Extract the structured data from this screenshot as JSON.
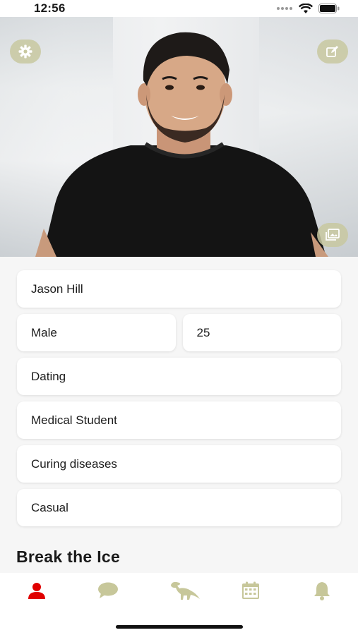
{
  "status": {
    "time": "12:56"
  },
  "profile": {
    "name": "Jason Hill",
    "gender": "Male",
    "age": "25",
    "looking_for": "Dating",
    "occupation": "Medical Student",
    "passion": "Curing diseases",
    "style": "Casual"
  },
  "section": {
    "break_the_ice": "Break the Ice"
  },
  "tabs": [
    {
      "icon": "person-icon",
      "active": true
    },
    {
      "icon": "chat-bubble-icon",
      "active": false
    },
    {
      "icon": "dinosaur-icon",
      "active": false
    },
    {
      "icon": "calendar-icon",
      "active": false
    },
    {
      "icon": "bell-icon",
      "active": false
    }
  ],
  "colors": {
    "accent": "#e00000",
    "inactive": "#c7c79a",
    "button_bg": "#c8c8a0"
  }
}
